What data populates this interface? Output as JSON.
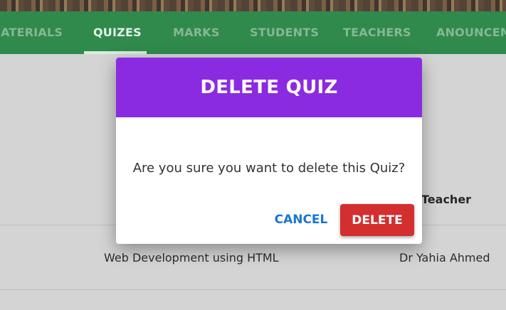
{
  "nav": {
    "items": [
      {
        "label": "MATERIALS"
      },
      {
        "label": "QUIZES"
      },
      {
        "label": "MARKS"
      },
      {
        "label": "STUDENTS"
      },
      {
        "label": "TEACHERS"
      },
      {
        "label": "ANOUNCEMENTS"
      }
    ],
    "active": "QUIZES"
  },
  "table": {
    "headers": [
      "Teacher"
    ],
    "rows": [
      {
        "title": "Web Development using HTML",
        "teacher": "Dr Yahia Ahmed"
      }
    ]
  },
  "dialog": {
    "title": "DELETE QUIZ",
    "message": "Are you sure you want to delete this Quiz?",
    "cancel_label": "CANCEL",
    "delete_label": "DELETE"
  },
  "colors": {
    "nav_bg": "#2f8a4c",
    "dialog_header": "#8a2be2",
    "delete_button": "#d32f2f",
    "cancel_text": "#1976d2"
  }
}
